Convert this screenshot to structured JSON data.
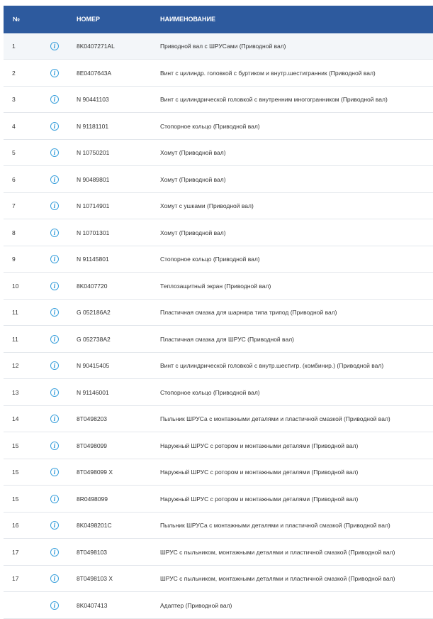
{
  "header": {
    "no_label": "№",
    "number_label": "НОМЕР",
    "name_label": "НАИМЕНОВАНИЕ"
  },
  "info_icon": {
    "name": "info-icon",
    "color": "#3aa0dc"
  },
  "colors": {
    "header_bg": "#2d5a9e",
    "selected_row_bg": "#f3f6f9"
  },
  "rows": [
    {
      "no": "1",
      "number": "8K0407271AL",
      "name": "Приводной вал с ШРУСами (Приводной вал)"
    },
    {
      "no": "2",
      "number": "8E0407643A",
      "name": "Винт с цилиндр. головкой с буртиком и внутр.шестигранник (Приводной вал)"
    },
    {
      "no": "3",
      "number": "N 90441103",
      "name": "Винт с цилиндрической головкой с внутренним многогранником (Приводной вал)"
    },
    {
      "no": "4",
      "number": "N 91181101",
      "name": "Стопорное кольцо (Приводной вал)"
    },
    {
      "no": "5",
      "number": "N 10750201",
      "name": "Хомут (Приводной вал)"
    },
    {
      "no": "6",
      "number": "N 90489801",
      "name": "Хомут (Приводной вал)"
    },
    {
      "no": "7",
      "number": "N 10714901",
      "name": "Хомут с ушками (Приводной вал)"
    },
    {
      "no": "8",
      "number": "N 10701301",
      "name": "Хомут (Приводной вал)"
    },
    {
      "no": "9",
      "number": "N 91145801",
      "name": "Стопорное кольцо (Приводной вал)"
    },
    {
      "no": "10",
      "number": "8K0407720",
      "name": "Теплозащитный экран (Приводной вал)"
    },
    {
      "no": "11",
      "number": "G 052186A2",
      "name": "Пластичная смазка для шарнира типа трипод (Приводной вал)"
    },
    {
      "no": "11",
      "number": "G 052738A2",
      "name": "Пластичная смазка для ШРУС (Приводной вал)"
    },
    {
      "no": "12",
      "number": "N 90415405",
      "name": "Винт с цилиндрической головкой с внутр.шестигр. (комбинир.) (Приводной вал)"
    },
    {
      "no": "13",
      "number": "N 91146001",
      "name": "Стопорное кольцо (Приводной вал)"
    },
    {
      "no": "14",
      "number": "8T0498203",
      "name": "Пыльник ШРУСа с монтажными деталями и пластичной смазкой (Приводной вал)"
    },
    {
      "no": "15",
      "number": "8T0498099",
      "name": "Наружный ШРУС с ротором и монтажными деталями (Приводной вал)"
    },
    {
      "no": "15",
      "number": "8T0498099 X",
      "name": "Наружный ШРУС с ротором и монтажными деталями (Приводной вал)"
    },
    {
      "no": "15",
      "number": "8R0498099",
      "name": "Наружный ШРУС с ротором и монтажными деталями (Приводной вал)"
    },
    {
      "no": "16",
      "number": "8K0498201C",
      "name": "Пыльник ШРУСа с монтажными деталями и пластичной смазкой (Приводной вал)"
    },
    {
      "no": "17",
      "number": "8T0498103",
      "name": "ШРУС с пыльником, монтажными деталями и пластичной смазкой (Приводной вал)"
    },
    {
      "no": "17",
      "number": "8T0498103 X",
      "name": "ШРУС с пыльником, монтажными деталями и пластичной смазкой (Приводной вал)"
    },
    {
      "no": "",
      "number": "8K0407413",
      "name": "Адаптер (Приводной вал)"
    }
  ]
}
